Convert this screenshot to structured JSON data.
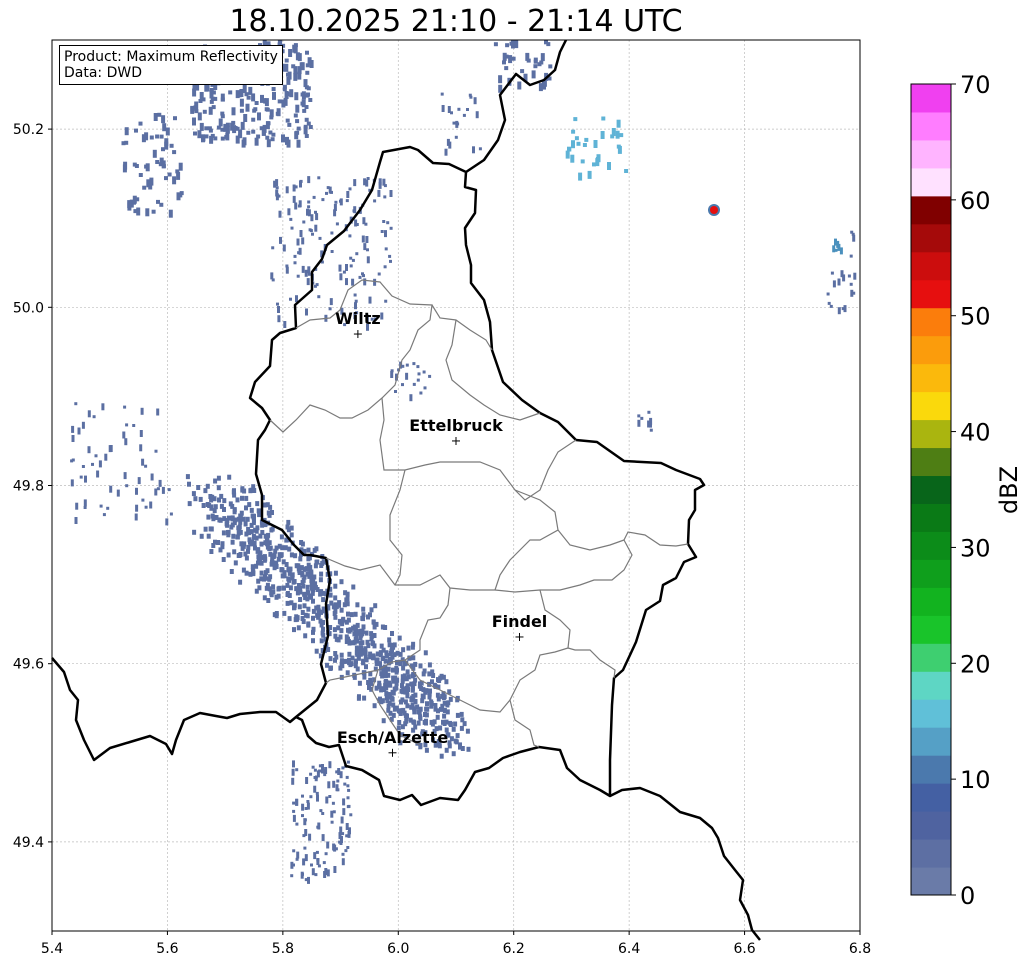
{
  "title": "18.10.2025 21:10 - 21:14 UTC",
  "info": {
    "product_line": "Product: Maximum Reflectivity",
    "data_line": "Data: DWD"
  },
  "axes": {
    "x_ticks": [
      "5.4",
      "5.6",
      "5.8",
      "6.0",
      "6.2",
      "6.4",
      "6.6",
      "6.8"
    ],
    "y_ticks": [
      "49.4",
      "49.6",
      "49.8",
      "50.0",
      "50.2"
    ],
    "lon_range": [
      5.4,
      6.8
    ],
    "lat_range": [
      49.3,
      50.3
    ],
    "grid": true
  },
  "places": [
    {
      "name": "Wiltz",
      "lon": 5.93,
      "lat": 49.97
    },
    {
      "name": "Ettelbruck",
      "lon": 6.1,
      "lat": 49.85
    },
    {
      "name": "Findel",
      "lon": 6.21,
      "lat": 49.63
    },
    {
      "name": "Esch/Alzette",
      "lon": 5.99,
      "lat": 49.5
    }
  ],
  "colorbar": {
    "label": "dBZ",
    "min": 0,
    "max": 70,
    "tick_labels": [
      "0",
      "10",
      "20",
      "30",
      "40",
      "50",
      "60",
      "70"
    ],
    "colors": [
      "#6a7ba8",
      "#5d6fa3",
      "#4f63a0",
      "#4460a3",
      "#4b79ad",
      "#55a0c6",
      "#60c0d8",
      "#5ed6c4",
      "#3ecf70",
      "#19c42a",
      "#12b31f",
      "#0f9f1c",
      "#0c8c19",
      "#0a7a16",
      "#08651a",
      "#4e7e14",
      "#aab50f",
      "#fad90c",
      "#fbb90c",
      "#fb9c0c",
      "#fb7d0c",
      "#e60f0f",
      "#cc0d0d",
      "#a50a0a",
      "#800000",
      "#ffe1ff",
      "#ffb4ff",
      "#ff7dff",
      "#f040f0"
    ]
  },
  "radar_color": "#5b6fa2"
}
